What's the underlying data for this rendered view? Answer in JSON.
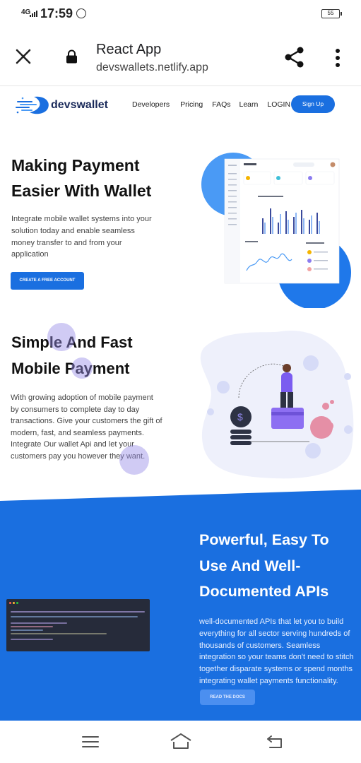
{
  "status_bar": {
    "network": "4G",
    "time": "17:59",
    "battery": "55"
  },
  "browser": {
    "title": "React App",
    "url": "devswallets.netlify.app"
  },
  "site_nav": {
    "logo_text": "devswallet",
    "links": [
      "Developers",
      "Pricing",
      "FAQs",
      "Learn",
      "LOGIN"
    ],
    "signup_label": "Sign Up"
  },
  "hero": {
    "title": "Making Payment Easier With Wallet",
    "description": "Integrate mobile wallet systems into your solution today and enable seamless money transfer to and from your application",
    "cta_label": "CREATE A FREE ACCOUNT"
  },
  "section_fast": {
    "title": "Simple And Fast Mobile Payment",
    "description": "With growing adoption of mobile payment by consumers to complete day to day transactions. Give your customers the gift of modern, fast, and seamless payments. Integrate Our wallet Api and let your customers pay you however they want."
  },
  "section_api": {
    "title": "Powerful, Easy To Use And Well-Documented APIs",
    "description": "well-documented APIs that let you to build everything for all sector serving hundreds of thousands of customers. Seamless integration so your teams don't need to stitch together disparate systems or spend months integrating wallet payments functionality.",
    "docs_label": "READ THE DOCS"
  },
  "colors": {
    "accent": "#1a6fe0",
    "bubble": "#968ce6",
    "code_bg": "#262b3a"
  },
  "icons": [
    "close-icon",
    "lock-icon",
    "share-icon",
    "more-vert-icon",
    "menu-icon",
    "home-icon",
    "back-icon"
  ]
}
